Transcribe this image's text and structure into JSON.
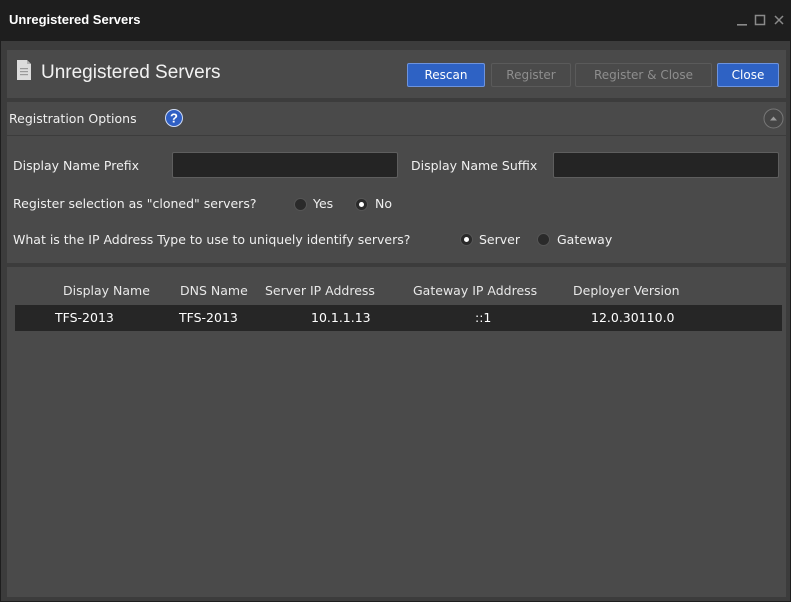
{
  "window": {
    "title": "Unregistered Servers",
    "controls": [
      "minimize-icon",
      "maximize-icon",
      "close-icon"
    ]
  },
  "header": {
    "title": "Unregistered Servers",
    "icon": "document-icon",
    "buttons": {
      "rescan": "Rescan",
      "register": "Register",
      "register_close": "Register & Close",
      "close": "Close"
    }
  },
  "options": {
    "title": "Registration Options",
    "prefix_label": "Display Name Prefix",
    "prefix_value": "",
    "suffix_label": "Display Name Suffix",
    "suffix_value": "",
    "cloned_label": "Register selection as \"cloned\" servers?",
    "cloned_yes": "Yes",
    "cloned_no": "No",
    "cloned_selected": "No",
    "ip_label": "What is the IP Address Type to use to uniquely identify servers?",
    "ip_server": "Server",
    "ip_gateway": "Gateway",
    "ip_selected": "Server"
  },
  "table": {
    "columns": [
      "Display Name",
      "DNS Name",
      "Server IP Address",
      "Gateway IP Address",
      "Deployer Version"
    ],
    "rows": [
      [
        "TFS-2013",
        "TFS-2013",
        "10.1.1.13",
        "::1",
        "12.0.30110.0"
      ]
    ]
  },
  "colors": {
    "primary_button": "#2e62c4",
    "titlebar": "#1e1e1e",
    "panel": "#4a4a4a",
    "background": "#3c3c3c"
  }
}
